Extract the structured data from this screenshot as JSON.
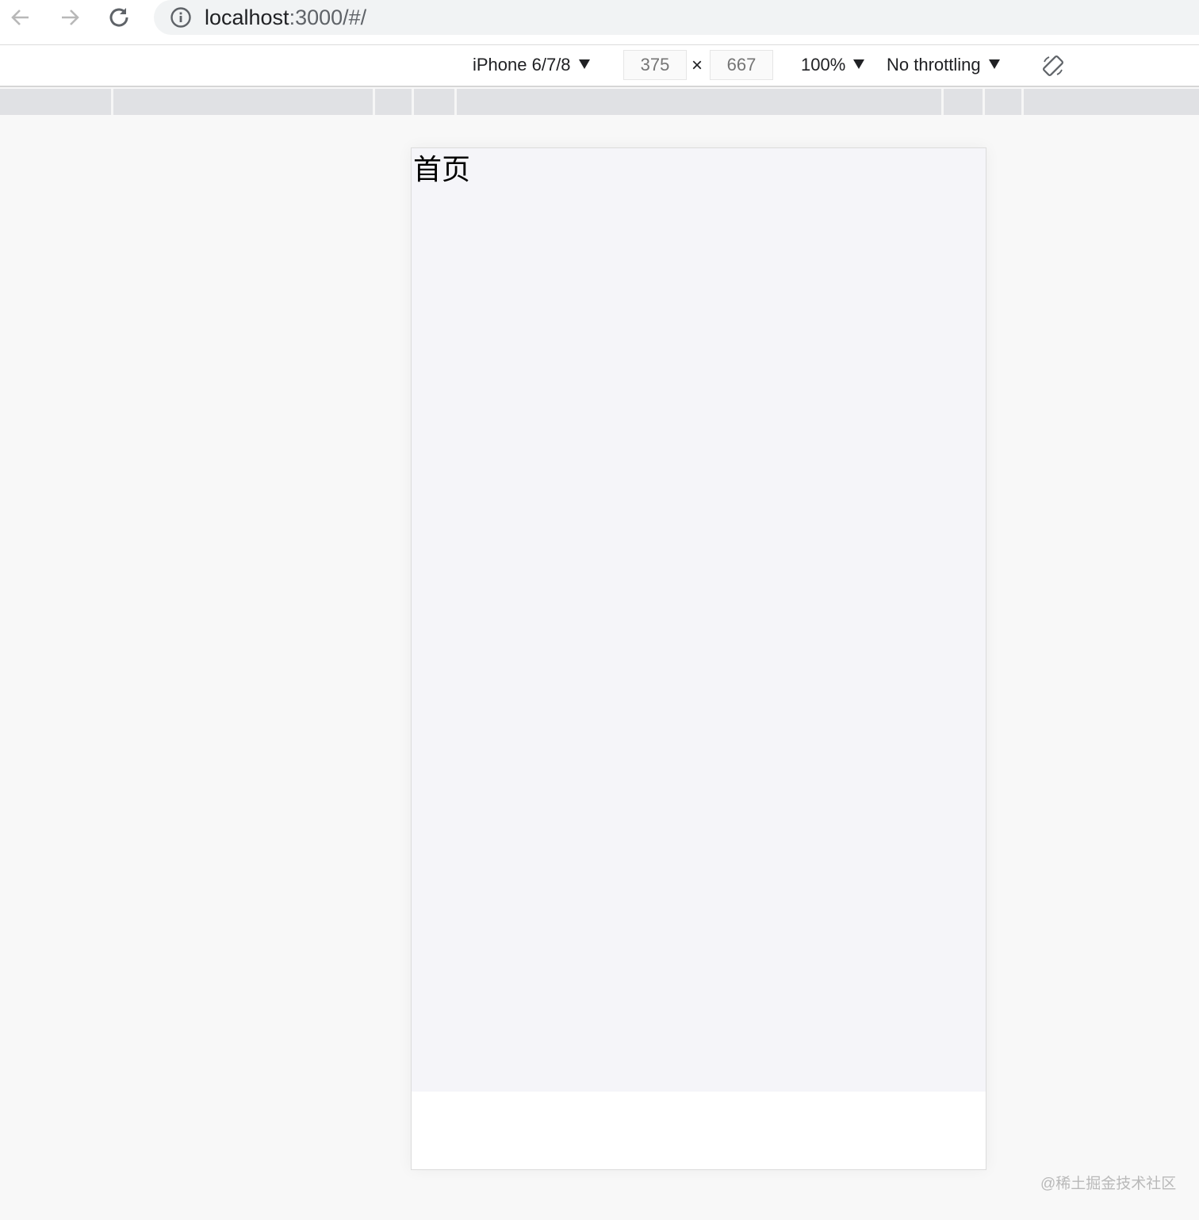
{
  "browser": {
    "url_host": "localhost",
    "url_path": ":3000/#/",
    "back_icon": "arrow-left",
    "forward_icon": "arrow-right",
    "reload_icon": "reload",
    "info_icon": "info-circle"
  },
  "device_toolbar": {
    "device": "iPhone 6/7/8",
    "width": "375",
    "height": "667",
    "times": "×",
    "zoom": "100%",
    "throttling": "No throttling",
    "rotate_icon": "rotate"
  },
  "page": {
    "heading": "首页"
  },
  "watermark": "@稀土掘金技术社区"
}
